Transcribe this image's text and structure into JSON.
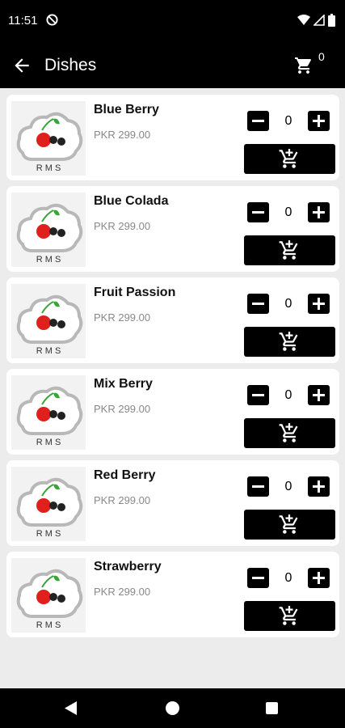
{
  "status_bar": {
    "time": "11:51"
  },
  "app_bar": {
    "title": "Dishes",
    "cart_count": "0"
  },
  "dishes": [
    {
      "name": "Blue Berry",
      "price": "PKR 299.00",
      "quantity": "0",
      "logo_text": "R M S"
    },
    {
      "name": "Blue Colada",
      "price": "PKR 299.00",
      "quantity": "0",
      "logo_text": "R M S"
    },
    {
      "name": "Fruit Passion",
      "price": "PKR 299.00",
      "quantity": "0",
      "logo_text": "R M S"
    },
    {
      "name": "Mix Berry",
      "price": "PKR 299.00",
      "quantity": "0",
      "logo_text": "R M S"
    },
    {
      "name": "Red Berry",
      "price": "PKR 299.00",
      "quantity": "0",
      "logo_text": "R M S"
    },
    {
      "name": "Strawberry",
      "price": "PKR 299.00",
      "quantity": "0",
      "logo_text": "R M S"
    }
  ],
  "colors": {
    "bar": "#000000",
    "background": "#ececec",
    "card": "#ffffff",
    "price": "#888888",
    "cherry": "#e0201c",
    "leaf": "#3aa537"
  }
}
